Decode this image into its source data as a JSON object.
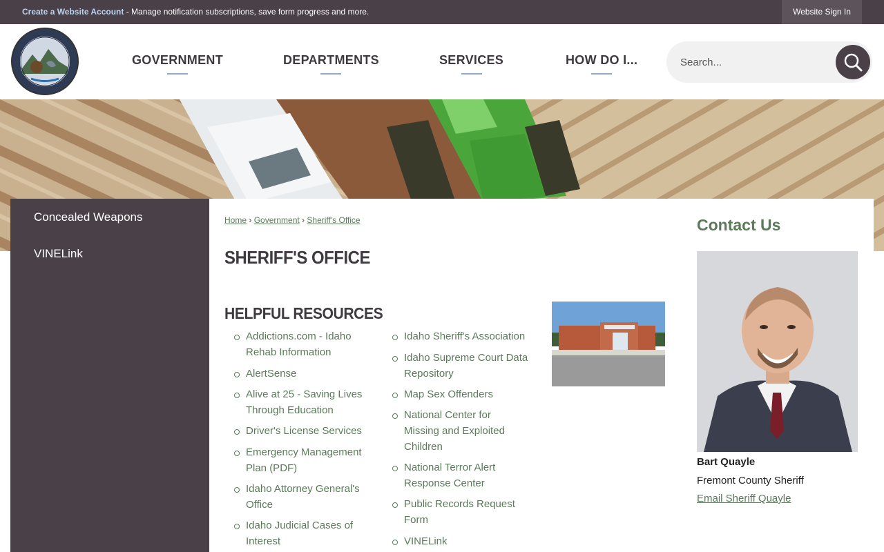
{
  "topbar": {
    "create_account": "Create a Website Account",
    "create_account_suffix": " - Manage notification subscriptions, save form progress and more.",
    "sign_in": "Website Sign In"
  },
  "header": {
    "logo_alt": "Fremont County",
    "nav": [
      "GOVERNMENT",
      "DEPARTMENTS",
      "SERVICES",
      "HOW DO I..."
    ],
    "search_placeholder": "Search...",
    "accent": "#8fa9c8"
  },
  "sidebar": {
    "items": [
      "Concealed Weapons",
      "VINELink"
    ]
  },
  "breadcrumb": [
    "Home",
    "Government",
    "Sheriff's Office"
  ],
  "page_title": "SHERIFF'S OFFICE",
  "resources": {
    "title": "HELPFUL RESOURCES",
    "col1": [
      "Addictions.com - Idaho Rehab Information",
      "AlertSense",
      "Alive at 25 - Saving Lives Through Education",
      "Driver's License Services",
      "Emergency Management Plan (PDF)",
      "Idaho Attorney General's Office",
      "Idaho Judicial Cases of Interest"
    ],
    "col2": [
      "Idaho Sheriff's Association",
      "Idaho Supreme Court Data Repository",
      "Map Sex Offenders",
      "National Center for Missing and Exploited Children",
      "National Terror Alert Response Center",
      "Public Records Request Form",
      "VINELink"
    ]
  },
  "contact": {
    "title": "Contact Us",
    "name": "Bart Quayle",
    "role": "Fremont County Sheriff",
    "email_label": "Email Sheriff Quayle"
  },
  "colors": {
    "dark": "#4a4048",
    "link_green": "#5a7a5a"
  }
}
